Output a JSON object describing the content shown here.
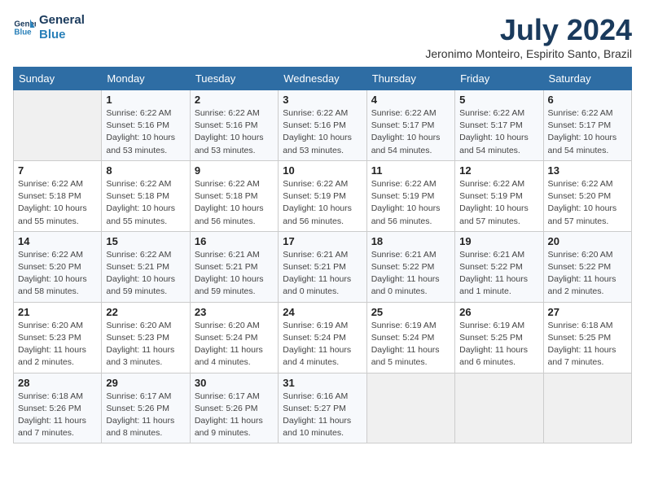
{
  "logo": {
    "line1": "General",
    "line2": "Blue"
  },
  "title": "July 2024",
  "location": "Jeronimo Monteiro, Espirito Santo, Brazil",
  "headers": [
    "Sunday",
    "Monday",
    "Tuesday",
    "Wednesday",
    "Thursday",
    "Friday",
    "Saturday"
  ],
  "weeks": [
    [
      {
        "day": "",
        "info": ""
      },
      {
        "day": "1",
        "info": "Sunrise: 6:22 AM\nSunset: 5:16 PM\nDaylight: 10 hours\nand 53 minutes."
      },
      {
        "day": "2",
        "info": "Sunrise: 6:22 AM\nSunset: 5:16 PM\nDaylight: 10 hours\nand 53 minutes."
      },
      {
        "day": "3",
        "info": "Sunrise: 6:22 AM\nSunset: 5:16 PM\nDaylight: 10 hours\nand 53 minutes."
      },
      {
        "day": "4",
        "info": "Sunrise: 6:22 AM\nSunset: 5:17 PM\nDaylight: 10 hours\nand 54 minutes."
      },
      {
        "day": "5",
        "info": "Sunrise: 6:22 AM\nSunset: 5:17 PM\nDaylight: 10 hours\nand 54 minutes."
      },
      {
        "day": "6",
        "info": "Sunrise: 6:22 AM\nSunset: 5:17 PM\nDaylight: 10 hours\nand 54 minutes."
      }
    ],
    [
      {
        "day": "7",
        "info": "Sunrise: 6:22 AM\nSunset: 5:18 PM\nDaylight: 10 hours\nand 55 minutes."
      },
      {
        "day": "8",
        "info": "Sunrise: 6:22 AM\nSunset: 5:18 PM\nDaylight: 10 hours\nand 55 minutes."
      },
      {
        "day": "9",
        "info": "Sunrise: 6:22 AM\nSunset: 5:18 PM\nDaylight: 10 hours\nand 56 minutes."
      },
      {
        "day": "10",
        "info": "Sunrise: 6:22 AM\nSunset: 5:19 PM\nDaylight: 10 hours\nand 56 minutes."
      },
      {
        "day": "11",
        "info": "Sunrise: 6:22 AM\nSunset: 5:19 PM\nDaylight: 10 hours\nand 56 minutes."
      },
      {
        "day": "12",
        "info": "Sunrise: 6:22 AM\nSunset: 5:19 PM\nDaylight: 10 hours\nand 57 minutes."
      },
      {
        "day": "13",
        "info": "Sunrise: 6:22 AM\nSunset: 5:20 PM\nDaylight: 10 hours\nand 57 minutes."
      }
    ],
    [
      {
        "day": "14",
        "info": "Sunrise: 6:22 AM\nSunset: 5:20 PM\nDaylight: 10 hours\nand 58 minutes."
      },
      {
        "day": "15",
        "info": "Sunrise: 6:22 AM\nSunset: 5:21 PM\nDaylight: 10 hours\nand 59 minutes."
      },
      {
        "day": "16",
        "info": "Sunrise: 6:21 AM\nSunset: 5:21 PM\nDaylight: 10 hours\nand 59 minutes."
      },
      {
        "day": "17",
        "info": "Sunrise: 6:21 AM\nSunset: 5:21 PM\nDaylight: 11 hours\nand 0 minutes."
      },
      {
        "day": "18",
        "info": "Sunrise: 6:21 AM\nSunset: 5:22 PM\nDaylight: 11 hours\nand 0 minutes."
      },
      {
        "day": "19",
        "info": "Sunrise: 6:21 AM\nSunset: 5:22 PM\nDaylight: 11 hours\nand 1 minute."
      },
      {
        "day": "20",
        "info": "Sunrise: 6:20 AM\nSunset: 5:22 PM\nDaylight: 11 hours\nand 2 minutes."
      }
    ],
    [
      {
        "day": "21",
        "info": "Sunrise: 6:20 AM\nSunset: 5:23 PM\nDaylight: 11 hours\nand 2 minutes."
      },
      {
        "day": "22",
        "info": "Sunrise: 6:20 AM\nSunset: 5:23 PM\nDaylight: 11 hours\nand 3 minutes."
      },
      {
        "day": "23",
        "info": "Sunrise: 6:20 AM\nSunset: 5:24 PM\nDaylight: 11 hours\nand 4 minutes."
      },
      {
        "day": "24",
        "info": "Sunrise: 6:19 AM\nSunset: 5:24 PM\nDaylight: 11 hours\nand 4 minutes."
      },
      {
        "day": "25",
        "info": "Sunrise: 6:19 AM\nSunset: 5:24 PM\nDaylight: 11 hours\nand 5 minutes."
      },
      {
        "day": "26",
        "info": "Sunrise: 6:19 AM\nSunset: 5:25 PM\nDaylight: 11 hours\nand 6 minutes."
      },
      {
        "day": "27",
        "info": "Sunrise: 6:18 AM\nSunset: 5:25 PM\nDaylight: 11 hours\nand 7 minutes."
      }
    ],
    [
      {
        "day": "28",
        "info": "Sunrise: 6:18 AM\nSunset: 5:26 PM\nDaylight: 11 hours\nand 7 minutes."
      },
      {
        "day": "29",
        "info": "Sunrise: 6:17 AM\nSunset: 5:26 PM\nDaylight: 11 hours\nand 8 minutes."
      },
      {
        "day": "30",
        "info": "Sunrise: 6:17 AM\nSunset: 5:26 PM\nDaylight: 11 hours\nand 9 minutes."
      },
      {
        "day": "31",
        "info": "Sunrise: 6:16 AM\nSunset: 5:27 PM\nDaylight: 11 hours\nand 10 minutes."
      },
      {
        "day": "",
        "info": ""
      },
      {
        "day": "",
        "info": ""
      },
      {
        "day": "",
        "info": ""
      }
    ]
  ]
}
